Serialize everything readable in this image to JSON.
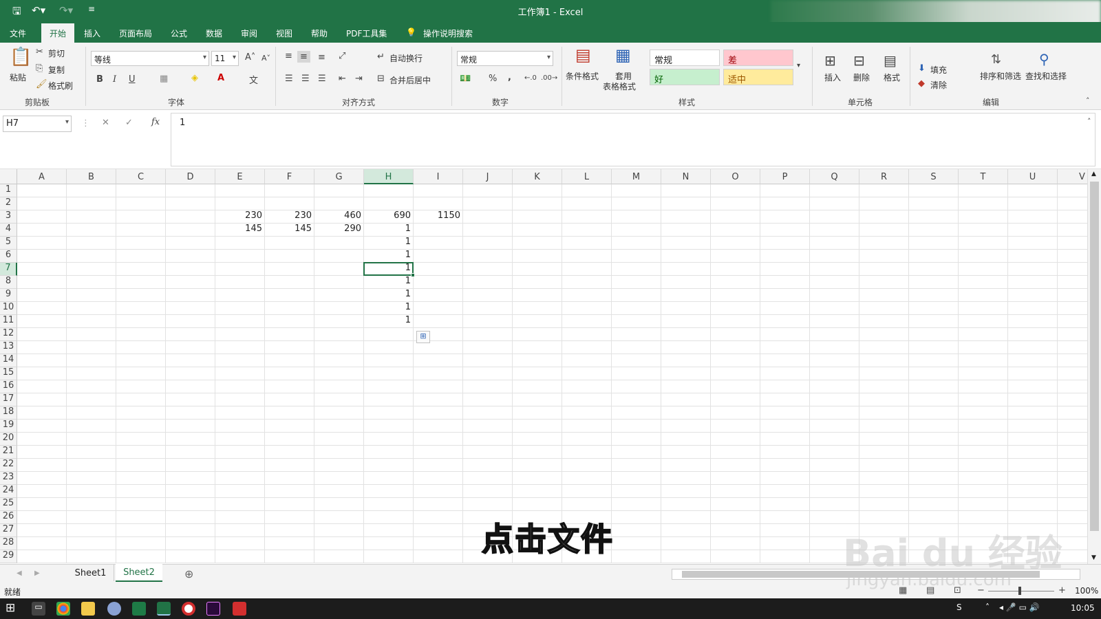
{
  "title_bar": {
    "title": "工作簿1 - Excel"
  },
  "tabs": [
    {
      "label": "文件"
    },
    {
      "label": "开始"
    },
    {
      "label": "插入"
    },
    {
      "label": "页面布局"
    },
    {
      "label": "公式"
    },
    {
      "label": "数据"
    },
    {
      "label": "审阅"
    },
    {
      "label": "视图"
    },
    {
      "label": "帮助"
    },
    {
      "label": "PDF工具集"
    },
    {
      "label": "操作说明搜索"
    }
  ],
  "ribbon": {
    "clipboard": {
      "paste": "粘贴",
      "cut": "剪切",
      "copy": "复制",
      "format_painter": "格式刷",
      "group": "剪贴板"
    },
    "font": {
      "name": "等线",
      "size": "11",
      "group": "字体",
      "bold": "B",
      "italic": "I",
      "underline": "U"
    },
    "alignment": {
      "wrap": "自动换行",
      "merge": "合并后居中",
      "group": "对齐方式"
    },
    "number": {
      "format": "常规",
      "group": "数字",
      "percent": "%",
      "comma": ","
    },
    "styles": {
      "conditional": "条件格式",
      "table_line1": "套用",
      "table_line2": "表格格式",
      "normal": "常规",
      "bad": "差",
      "good": "好",
      "neutral": "适中",
      "group": "样式"
    },
    "cells": {
      "insert": "插入",
      "delete": "删除",
      "format": "格式",
      "group": "单元格"
    },
    "editing": {
      "fill": "填充",
      "clear": "清除",
      "sort": "排序和筛选",
      "find": "查找和选择",
      "group": "编辑"
    }
  },
  "formula_bar": {
    "name_box": "H7",
    "fx": "fx",
    "content": "1"
  },
  "columns": [
    "A",
    "B",
    "C",
    "D",
    "E",
    "F",
    "G",
    "H",
    "I",
    "J",
    "K",
    "L",
    "M",
    "N",
    "O",
    "P",
    "Q",
    "R",
    "S",
    "T",
    "U",
    "V"
  ],
  "rows": [
    "1",
    "2",
    "3",
    "4",
    "5",
    "6",
    "7",
    "8",
    "9",
    "10",
    "11",
    "12",
    "13",
    "14",
    "15",
    "16",
    "17",
    "18",
    "19",
    "20",
    "21",
    "22",
    "23",
    "24",
    "25",
    "26",
    "27",
    "28",
    "29"
  ],
  "cells": {
    "E3": "230",
    "F3": "230",
    "G3": "460",
    "H3": "690",
    "I3": "1150",
    "E4": "145",
    "F4": "145",
    "G4": "290",
    "H4": "1",
    "H5": "1",
    "H6": "1",
    "H7": "1",
    "H8": "1",
    "H9": "1",
    "H10": "1",
    "H11": "1"
  },
  "selected_cell": "H7",
  "sheets": [
    {
      "label": "Sheet1"
    },
    {
      "label": "Sheet2"
    }
  ],
  "active_sheet": "Sheet2",
  "status": {
    "ready": "就绪",
    "zoom": "100%"
  },
  "taskbar": {
    "time": "10:05"
  },
  "subtitle": "点击文件",
  "watermark": {
    "main": "Bai du 经验",
    "url": "jingyan.baidu.com"
  },
  "colors": {
    "accent": "#217346",
    "bad_bg": "#ffc7ce",
    "bad_fg": "#9c0006",
    "good_bg": "#c6efce",
    "good_fg": "#006100",
    "neutral_bg": "#ffeb9c",
    "neutral_fg": "#9c5700"
  }
}
